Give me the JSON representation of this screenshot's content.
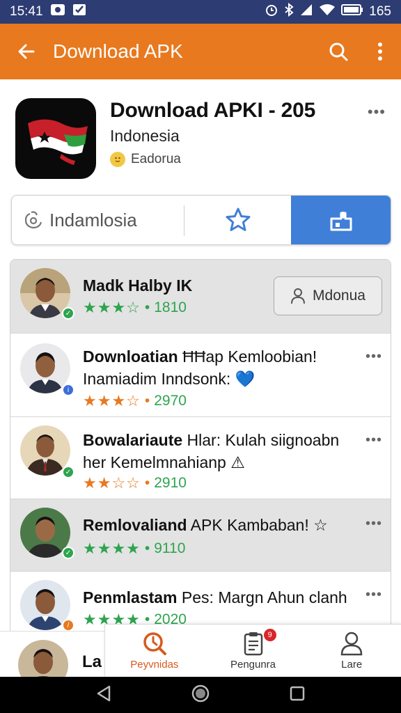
{
  "status_bar": {
    "time": "15:41",
    "battery": "165"
  },
  "app_bar": {
    "title": "Download APK",
    "back_icon": "back-arrow-icon",
    "search_icon": "search-icon",
    "more_icon": "more-vert-icon"
  },
  "app": {
    "title": "Download APKI - 205",
    "subtitle": "Indonesia",
    "developer": "Eadorua",
    "developer_icon": "emoji-face-icon",
    "more": "•••"
  },
  "actions": {
    "region_label": "Indamlosia",
    "region_icon": "region-icon",
    "star_icon": "star-icon",
    "install_icon": "install-icon"
  },
  "reviews": [
    {
      "name": "Madk Halby IK",
      "text": "",
      "rating": "1810",
      "stars": "★★★☆",
      "button": "Mdonua",
      "badge_color": "#2ea44f"
    },
    {
      "name": "Downloatian",
      "text": " ĦĦap Kemloobian!",
      "line2": "Inamiadim Inndsonk: 💙",
      "rating": "2970",
      "stars": "★★★☆",
      "badge_color": "#3b6fd8"
    },
    {
      "name": "Bowalariaute",
      "text": " Hlar: Kulah siignoabn",
      "line2": "her Kemelmnahianp ⚠",
      "rating": "2910",
      "stars": "★★☆☆",
      "badge_color": "#2ea44f"
    },
    {
      "name": "Remlovaliand",
      "text": " APK Kambaban! ☆",
      "rating": "9110",
      "stars": "★★★★",
      "badge_color": "#2ea44f"
    },
    {
      "name": "Penmlastam",
      "text": " Pes: Margn Ahun clanh",
      "rating": "2020",
      "stars": "★★★★",
      "badge_color": "#e8791f"
    }
  ],
  "peek_row": {
    "name": "La"
  },
  "more_dots": "•••",
  "rating_sep": "•",
  "bottom_nav": {
    "items": [
      {
        "label": "Peyvnidas",
        "icon": "discover-icon",
        "active": true
      },
      {
        "label": "Pengunra",
        "icon": "clipboard-icon",
        "badge": "9"
      },
      {
        "label": "Lare",
        "icon": "profile-icon"
      }
    ]
  },
  "colors": {
    "accent": "#e8791f",
    "primary": "#3f7fd8",
    "green": "#2ea44f",
    "orange_star": "#e8791f",
    "status_bar": "#2d3c72"
  }
}
